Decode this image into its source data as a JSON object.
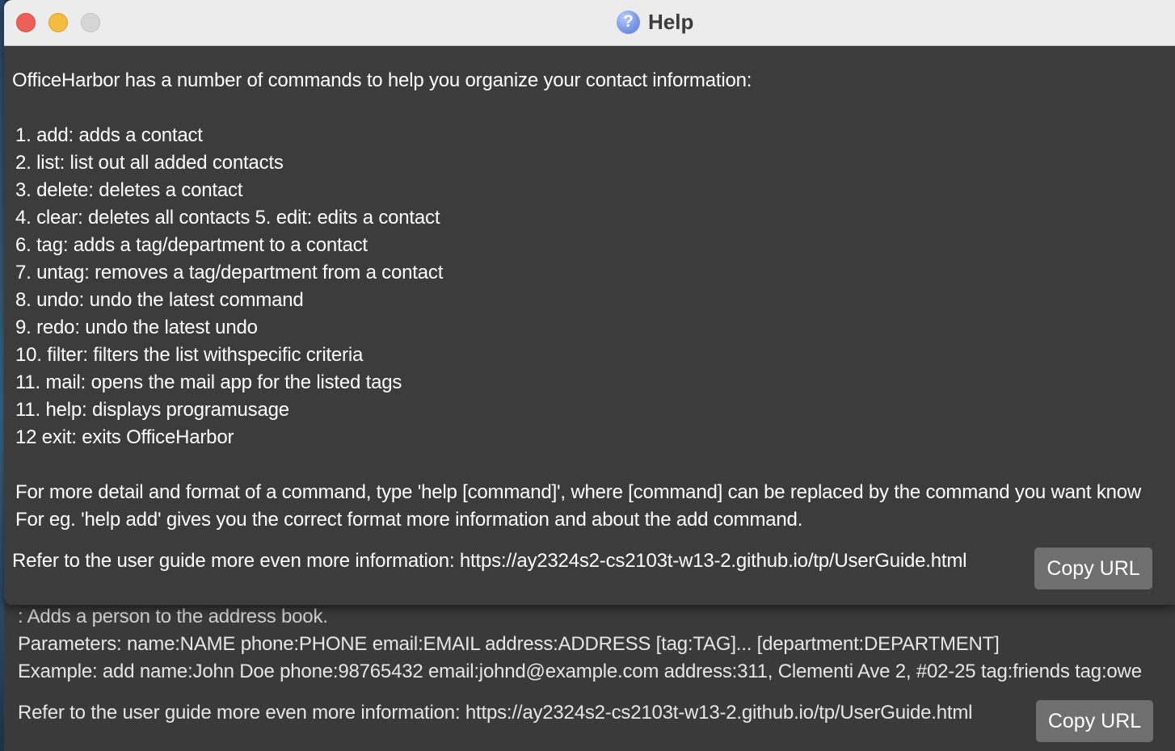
{
  "window": {
    "title": "Help",
    "icon": "help-question-icon"
  },
  "help": {
    "intro": "OfficeHarbor has a number of commands to help you organize your contact information:",
    "commands": [
      "1. add: adds a contact",
      "2. list: list out all added contacts",
      "3. delete: deletes a contact",
      "4. clear: deletes all contacts 5. edit: edits a contact",
      "6. tag: adds a tag/department to a contact",
      "7. untag: removes a tag/department from a contact",
      "8. undo: undo the latest command",
      "9. redo: undo the latest undo",
      "10. filter: filters the list withspecific criteria",
      "11. mail: opens the mail app for the listed tags",
      "11. help: displays programusage",
      "12 exit: exits OfficeHarbor"
    ],
    "detail_line_1": "For more detail and format of a command, type 'help [command]', where [command] can be replaced by the command you want know",
    "detail_line_2": "For eg. 'help add' gives you the correct format more information and about the add command.",
    "guide_text": "Refer to the user guide more even more information: https://ay2324s2-cs2103t-w13-2.github.io/tp/UserGuide.html",
    "copy_button": "Copy URL"
  },
  "back_window": {
    "line_1": ": Adds a person to the address book.",
    "line_2": "Parameters: name:NAME phone:PHONE email:EMAIL address:ADDRESS [tag:TAG]... [department:DEPARTMENT]",
    "line_3": "Example: add name:John Doe phone:98765432 email:johnd@example.com address:311, Clementi Ave 2, #02-25 tag:friends tag:owe",
    "guide_text": "Refer to the user guide more even more information: https://ay2324s2-cs2103t-w13-2.github.io/tp/UserGuide.html",
    "copy_button": "Copy URL"
  },
  "colors": {
    "window_bg": "#3c3c3c",
    "titlebar_bg": "#ececec",
    "button_bg": "#6f6f6f",
    "close": "#ee5f57",
    "minimize": "#f3bc3f",
    "zoom_disabled": "#d6d6d6"
  }
}
